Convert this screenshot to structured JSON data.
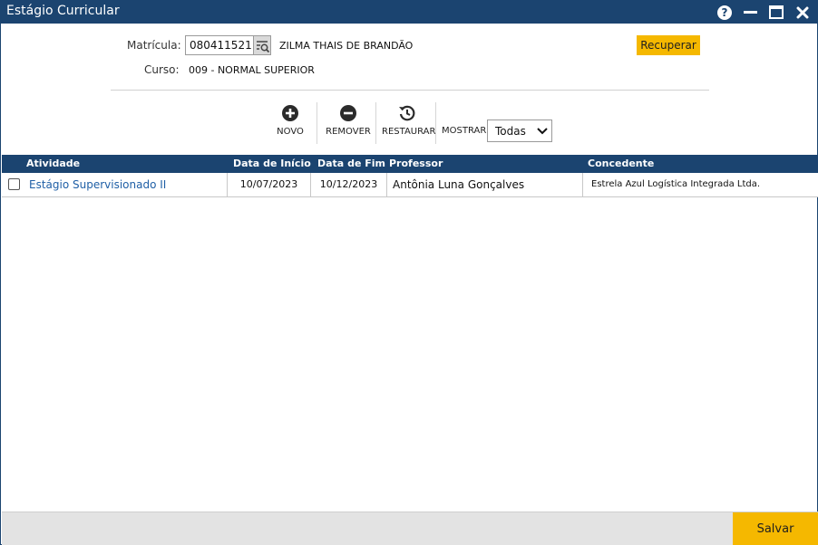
{
  "window": {
    "title": "Estágio Curricular",
    "help_icon": "help-icon",
    "minimize_icon": "minimize-icon",
    "maximize_icon": "maximize-icon",
    "close_icon": "close-icon"
  },
  "form": {
    "matricula_label": "Matrícula:",
    "matricula_value": "080411521",
    "student_name": "ZILMA THAIS DE BRANDÃO",
    "curso_label": "Curso:",
    "curso_value": "009 - NORMAL SUPERIOR",
    "recuperar_label": "Recuperar"
  },
  "toolbar": {
    "novo_label": "NOVO",
    "remover_label": "REMOVER",
    "restaurar_label": "RESTAURAR",
    "mostrar_label": "MOSTRAR:",
    "mostrar_value": "Todas"
  },
  "table": {
    "columns": [
      "Atividade",
      "Data de Início",
      "Data de Fim",
      "Professor",
      "Concedente"
    ],
    "rows": [
      {
        "checked": false,
        "atividade": "Estágio Supervisionado II",
        "data_inicio": "10/07/2023",
        "data_fim": "10/12/2023",
        "professor": "Antônia Luna Gonçalves",
        "concedente": "Estrela Azul Logística Integrada Ltda."
      }
    ]
  },
  "footer": {
    "salvar_label": "Salvar"
  },
  "colors": {
    "primary": "#1b4470",
    "accent": "#f5b800",
    "link": "#1f5fa6"
  }
}
